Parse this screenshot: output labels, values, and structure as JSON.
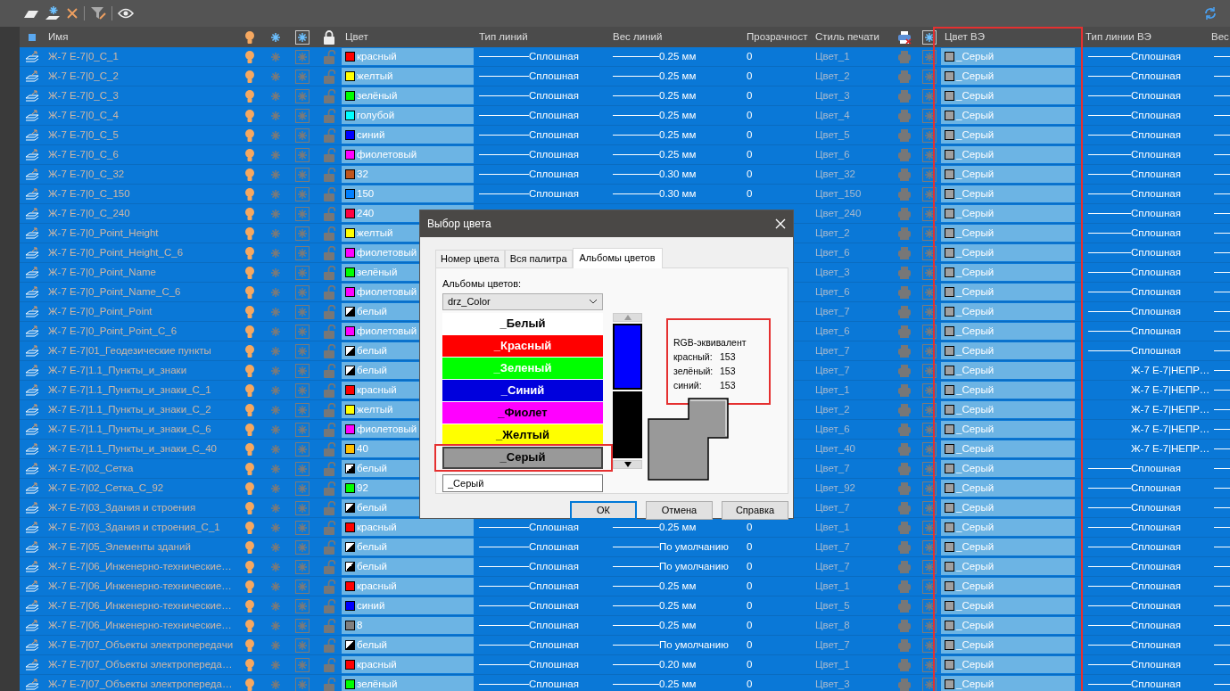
{
  "table": {
    "columns": [
      "Имя",
      "Цвет",
      "Тип линий",
      "Вес линий",
      "Прозрачност",
      "Стиль печати",
      "Цвет ВЭ",
      "Тип линии ВЭ",
      "Вес"
    ],
    "rows": [
      {
        "name": "Ж-7 Е-7|0_C_1",
        "color_name": "красный",
        "color": "#ff0000",
        "kind": "solid",
        "linetype": "Сплошная",
        "weight": "0.25 мм",
        "transparency": "0",
        "plot_style": "Цвет_1",
        "ve_color": "_Серый",
        "ve_linetype": "Сплошная",
        "ve_sample": true,
        "on": true,
        "frozen": false,
        "locked": false,
        "selected": true
      },
      {
        "name": "Ж-7 Е-7|0_C_2",
        "color_name": "желтый",
        "color": "#ffff00",
        "kind": "solid",
        "linetype": "Сплошная",
        "weight": "0.25 мм",
        "transparency": "0",
        "plot_style": "Цвет_2",
        "ve_color": "_Серый",
        "ve_linetype": "Сплошная",
        "ve_sample": true,
        "on": true,
        "frozen": false,
        "locked": false,
        "selected": true
      },
      {
        "name": "Ж-7 Е-7|0_C_3",
        "color_name": "зелёный",
        "color": "#00ff00",
        "kind": "solid",
        "linetype": "Сплошная",
        "weight": "0.25 мм",
        "transparency": "0",
        "plot_style": "Цвет_3",
        "ve_color": "_Серый",
        "ve_linetype": "Сплошная",
        "ve_sample": true,
        "on": true,
        "frozen": false,
        "locked": false,
        "selected": true
      },
      {
        "name": "Ж-7 Е-7|0_C_4",
        "color_name": "голубой",
        "color": "#00ffff",
        "kind": "solid",
        "linetype": "Сплошная",
        "weight": "0.25 мм",
        "transparency": "0",
        "plot_style": "Цвет_4",
        "ve_color": "_Серый",
        "ve_linetype": "Сплошная",
        "ve_sample": true,
        "on": true,
        "frozen": false,
        "locked": false,
        "selected": true
      },
      {
        "name": "Ж-7 Е-7|0_C_5",
        "color_name": "синий",
        "color": "#0000ff",
        "kind": "solid",
        "linetype": "Сплошная",
        "weight": "0.25 мм",
        "transparency": "0",
        "plot_style": "Цвет_5",
        "ve_color": "_Серый",
        "ve_linetype": "Сплошная",
        "ve_sample": true,
        "on": true,
        "frozen": false,
        "locked": false,
        "selected": true
      },
      {
        "name": "Ж-7 Е-7|0_C_6",
        "color_name": "фиолетовый",
        "color": "#ff00ff",
        "kind": "solid",
        "linetype": "Сплошная",
        "weight": "0.25 мм",
        "transparency": "0",
        "plot_style": "Цвет_6",
        "ve_color": "_Серый",
        "ve_linetype": "Сплошная",
        "ve_sample": true,
        "on": true,
        "frozen": false,
        "locked": false,
        "selected": true
      },
      {
        "name": "Ж-7 Е-7|0_C_32",
        "color_name": "32",
        "color": "#c0561c",
        "kind": "solid",
        "linetype": "Сплошная",
        "weight": "0.30 мм",
        "transparency": "0",
        "plot_style": "Цвет_32",
        "ve_color": "_Серый",
        "ve_linetype": "Сплошная",
        "ve_sample": true,
        "on": true,
        "frozen": false,
        "locked": false,
        "selected": true
      },
      {
        "name": "Ж-7 Е-7|0_C_150",
        "color_name": "150",
        "color": "#0080ff",
        "kind": "solid",
        "linetype": "Сплошная",
        "weight": "0.30 мм",
        "transparency": "0",
        "plot_style": "Цвет_150",
        "ve_color": "_Серый",
        "ve_linetype": "Сплошная",
        "ve_sample": true,
        "on": true,
        "frozen": false,
        "locked": false,
        "selected": true
      },
      {
        "name": "Ж-7 Е-7|0_C_240",
        "color_name": "240",
        "color": "#ff0040",
        "kind": "solid",
        "plot_style": "Цвет_240",
        "ve_color": "_Серый",
        "ve_linetype": "Сплошная",
        "ve_sample": true,
        "on": true,
        "frozen": false,
        "locked": false,
        "selected": true
      },
      {
        "name": "Ж-7 Е-7|0_Point_Height",
        "color_name": "желтый",
        "color": "#ffff00",
        "kind": "solid",
        "plot_style": "Цвет_2",
        "ve_color": "_Серый",
        "ve_linetype": "Сплошная",
        "ve_sample": true,
        "on": true,
        "frozen": false,
        "locked": false,
        "selected": true
      },
      {
        "name": "Ж-7 Е-7|0_Point_Height_C_6",
        "color_name": "фиолетовый",
        "color": "#ff00ff",
        "kind": "solid",
        "plot_style": "Цвет_6",
        "ve_color": "_Серый",
        "ve_linetype": "Сплошная",
        "ve_sample": true,
        "on": true,
        "frozen": false,
        "locked": false,
        "selected": true
      },
      {
        "name": "Ж-7 Е-7|0_Point_Name",
        "color_name": "зелёный",
        "color": "#00ff00",
        "kind": "solid",
        "plot_style": "Цвет_3",
        "ve_color": "_Серый",
        "ve_linetype": "Сплошная",
        "ve_sample": true,
        "on": true,
        "frozen": false,
        "locked": false,
        "selected": true
      },
      {
        "name": "Ж-7 Е-7|0_Point_Name_C_6",
        "color_name": "фиолетовый",
        "color": "#ff00ff",
        "kind": "solid",
        "plot_style": "Цвет_6",
        "ve_color": "_Серый",
        "ve_linetype": "Сплошная",
        "ve_sample": true,
        "on": true,
        "frozen": false,
        "locked": false,
        "selected": true
      },
      {
        "name": "Ж-7 Е-7|0_Point_Point",
        "color_name": "белый",
        "color": "#ffffff",
        "kind": "split",
        "plot_style": "Цвет_7",
        "ve_color": "_Серый",
        "ve_linetype": "Сплошная",
        "ve_sample": true,
        "on": true,
        "frozen": false,
        "locked": false,
        "selected": true
      },
      {
        "name": "Ж-7 Е-7|0_Point_Point_C_6",
        "color_name": "фиолетовый",
        "color": "#ff00ff",
        "kind": "solid",
        "plot_style": "Цвет_6",
        "ve_color": "_Серый",
        "ve_linetype": "Сплошная",
        "ve_sample": true,
        "on": true,
        "frozen": false,
        "locked": false,
        "selected": true
      },
      {
        "name": "Ж-7 Е-7|01_Геодезические пункты",
        "color_name": "белый",
        "color": "#ffffff",
        "kind": "split",
        "plot_style": "Цвет_7",
        "ve_color": "_Серый",
        "ve_linetype": "Сплошная",
        "ve_sample": true,
        "on": true,
        "frozen": false,
        "locked": false,
        "selected": true
      },
      {
        "name": "Ж-7 Е-7|1.1_Пункты_и_знаки",
        "color_name": "белый",
        "color": "#ffffff",
        "kind": "split",
        "plot_style": "Цвет_7",
        "ve_color": "_Серый",
        "ve_linetype": "Ж-7 Е-7|НЕПР…",
        "ve_sample": false,
        "on": true,
        "frozen": false,
        "locked": false,
        "selected": true
      },
      {
        "name": "Ж-7 Е-7|1.1_Пункты_и_знаки_C_1",
        "color_name": "красный",
        "color": "#ff0000",
        "kind": "solid",
        "plot_style": "Цвет_1",
        "ve_color": "_Серый",
        "ve_linetype": "Ж-7 Е-7|НЕПР…",
        "ve_sample": false,
        "on": true,
        "frozen": false,
        "locked": false,
        "selected": true
      },
      {
        "name": "Ж-7 Е-7|1.1_Пункты_и_знаки_C_2",
        "color_name": "желтый",
        "color": "#ffff00",
        "kind": "solid",
        "plot_style": "Цвет_2",
        "ve_color": "_Серый",
        "ve_linetype": "Ж-7 Е-7|НЕПР…",
        "ve_sample": false,
        "on": true,
        "frozen": false,
        "locked": false,
        "selected": true
      },
      {
        "name": "Ж-7 Е-7|1.1_Пункты_и_знаки_C_6",
        "color_name": "фиолетовый",
        "color": "#ff00ff",
        "kind": "solid",
        "plot_style": "Цвет_6",
        "ve_color": "_Серый",
        "ve_linetype": "Ж-7 Е-7|НЕПР…",
        "ve_sample": false,
        "on": true,
        "frozen": false,
        "locked": false,
        "selected": true
      },
      {
        "name": "Ж-7 Е-7|1.1_Пункты_и_знаки_C_40",
        "color_name": "40",
        "color": "#ffbf00",
        "kind": "solid",
        "plot_style": "Цвет_40",
        "ve_color": "_Серый",
        "ve_linetype": "Ж-7 Е-7|НЕПР…",
        "ve_sample": false,
        "on": true,
        "frozen": false,
        "locked": false,
        "selected": true
      },
      {
        "name": "Ж-7 Е-7|02_Сетка",
        "color_name": "белый",
        "color": "#ffffff",
        "kind": "split",
        "plot_style": "Цвет_7",
        "ve_color": "_Серый",
        "ve_linetype": "Сплошная",
        "ve_sample": true,
        "on": true,
        "frozen": false,
        "locked": false,
        "selected": true
      },
      {
        "name": "Ж-7 Е-7|02_Сетка_C_92",
        "color_name": "92",
        "color": "#00ff00",
        "kind": "solid",
        "plot_style": "Цвет_92",
        "ve_color": "_Серый",
        "ve_linetype": "Сплошная",
        "ve_sample": true,
        "on": true,
        "frozen": false,
        "locked": false,
        "selected": true
      },
      {
        "name": "Ж-7 Е-7|03_Здания и строения",
        "color_name": "белый",
        "color": "#ffffff",
        "kind": "split",
        "plot_style": "Цвет_7",
        "ve_color": "_Серый",
        "ve_linetype": "Сплошная",
        "ve_sample": true,
        "on": true,
        "frozen": false,
        "locked": false,
        "selected": true
      },
      {
        "name": "Ж-7 Е-7|03_Здания и строения_C_1",
        "color_name": "красный",
        "color": "#ff0000",
        "kind": "solid",
        "linetype": "Сплошная",
        "weight": "0.25 мм",
        "transparency": "0",
        "plot_style": "Цвет_1",
        "ve_color": "_Серый",
        "ve_linetype": "Сплошная",
        "ve_sample": true,
        "on": true,
        "frozen": false,
        "locked": false,
        "selected": true
      },
      {
        "name": "Ж-7 Е-7|05_Элементы зданий",
        "color_name": "белый",
        "color": "#ffffff",
        "kind": "split",
        "linetype": "Сплошная",
        "weight": "По умолчанию",
        "transparency": "0",
        "plot_style": "Цвет_7",
        "ve_color": "_Серый",
        "ve_linetype": "Сплошная",
        "ve_sample": true,
        "on": true,
        "frozen": false,
        "locked": false,
        "selected": true
      },
      {
        "name": "Ж-7 Е-7|06_Инженерно-технические…",
        "color_name": "белый",
        "color": "#ffffff",
        "kind": "split",
        "linetype": "Сплошная",
        "weight": "По умолчанию",
        "transparency": "0",
        "plot_style": "Цвет_7",
        "ve_color": "_Серый",
        "ve_linetype": "Сплошная",
        "ve_sample": true,
        "on": true,
        "frozen": false,
        "locked": false,
        "selected": true
      },
      {
        "name": "Ж-7 Е-7|06_Инженерно-технические…",
        "color_name": "красный",
        "color": "#ff0000",
        "kind": "solid",
        "linetype": "Сплошная",
        "weight": "0.25 мм",
        "transparency": "0",
        "plot_style": "Цвет_1",
        "ve_color": "_Серый",
        "ve_linetype": "Сплошная",
        "ve_sample": true,
        "on": true,
        "frozen": false,
        "locked": false,
        "selected": true
      },
      {
        "name": "Ж-7 Е-7|06_Инженерно-технические…",
        "color_name": "синий",
        "color": "#0000ff",
        "kind": "solid",
        "linetype": "Сплошная",
        "weight": "0.25 мм",
        "transparency": "0",
        "plot_style": "Цвет_5",
        "ve_color": "_Серый",
        "ve_linetype": "Сплошная",
        "ve_sample": true,
        "on": true,
        "frozen": false,
        "locked": false,
        "selected": true
      },
      {
        "name": "Ж-7 Е-7|06_Инженерно-технические…",
        "color_name": "8",
        "color": "#808080",
        "kind": "solid",
        "linetype": "Сплошная",
        "weight": "0.25 мм",
        "transparency": "0",
        "plot_style": "Цвет_8",
        "ve_color": "_Серый",
        "ve_linetype": "Сплошная",
        "ve_sample": true,
        "on": true,
        "frozen": false,
        "locked": false,
        "selected": true
      },
      {
        "name": "Ж-7 Е-7|07_Объекты электропередачи",
        "color_name": "белый",
        "color": "#ffffff",
        "kind": "split",
        "linetype": "Сплошная",
        "weight": "По умолчанию",
        "transparency": "0",
        "plot_style": "Цвет_7",
        "ve_color": "_Серый",
        "ve_linetype": "Сплошная",
        "ve_sample": true,
        "on": true,
        "frozen": false,
        "locked": false,
        "selected": true
      },
      {
        "name": "Ж-7 Е-7|07_Объекты электропереда…",
        "color_name": "красный",
        "color": "#ff0000",
        "kind": "solid",
        "linetype": "Сплошная",
        "weight": "0.20 мм",
        "transparency": "0",
        "plot_style": "Цвет_1",
        "ve_color": "_Серый",
        "ve_linetype": "Сплошная",
        "ve_sample": true,
        "on": true,
        "frozen": false,
        "locked": false,
        "selected": true
      },
      {
        "name": "Ж-7 Е-7|07_Объекты электропереда…",
        "color_name": "зелёный",
        "color": "#00ff00",
        "kind": "solid",
        "linetype": "Сплошная",
        "weight": "0.25 мм",
        "transparency": "0",
        "plot_style": "Цвет_3",
        "ve_color": "_Серый",
        "ve_linetype": "Сплошная",
        "ve_sample": true,
        "on": true,
        "frozen": false,
        "locked": false,
        "selected": true
      }
    ]
  },
  "dialog": {
    "title": "Выбор цвета",
    "tabs": [
      {
        "label": "Номер цвета",
        "selected": false
      },
      {
        "label": "Вся палитра",
        "selected": false
      },
      {
        "label": "Альбомы цветов",
        "selected": true
      }
    ],
    "album_label": "Альбомы цветов:",
    "album": "drz_Color",
    "colors": [
      {
        "label": "_Белый",
        "color": "#ffffff",
        "kind": "dark",
        "selected": false
      },
      {
        "label": "_Красный",
        "color": "#ff0000",
        "kind": "light",
        "selected": false
      },
      {
        "label": "_Зеленый",
        "color": "#00ff00",
        "kind": "light",
        "selected": false
      },
      {
        "label": "_Синий",
        "color": "#0000dd",
        "kind": "light",
        "selected": false
      },
      {
        "label": "_Фиолет",
        "color": "#ff00ff",
        "kind": "dark",
        "selected": false
      },
      {
        "label": "_Желтый",
        "color": "#ffff00",
        "kind": "dark",
        "selected": false
      },
      {
        "label": "_Серый",
        "color": "#999999",
        "kind": "dark",
        "selected": true
      }
    ],
    "value": "_Серый",
    "rgb": {
      "title": "RGB-эквивалент",
      "rows": [
        {
          "label": "красный:",
          "value": "153"
        },
        {
          "label": "зелёный:",
          "value": "153"
        },
        {
          "label": "синий:",
          "value": "153"
        }
      ]
    },
    "buttons": [
      {
        "label": "ОК",
        "default": true
      },
      {
        "label": "Отмена",
        "default": false
      },
      {
        "label": "Справка",
        "default": false
      }
    ]
  }
}
